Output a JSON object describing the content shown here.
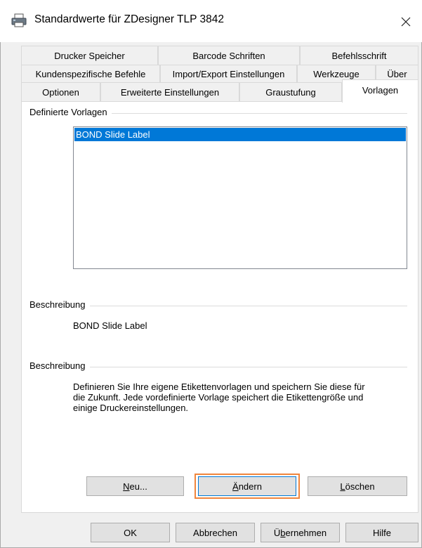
{
  "window": {
    "title": "Standardwerte für ZDesigner TLP 3842"
  },
  "tabs": {
    "row1": [
      "Drucker Speicher",
      "Barcode Schriften",
      "Befehlsschrift"
    ],
    "row2": [
      "Kundenspezifische Befehle",
      "Import/Export Einstellungen",
      "Werkzeuge",
      "Über"
    ],
    "row3": [
      "Optionen",
      "Erweiterte Einstellungen",
      "Graustufung",
      "Vorlagen"
    ],
    "active": "Vorlagen"
  },
  "templates": {
    "group_label": "Definierte Vorlagen",
    "items": [
      "BOND Slide Label"
    ],
    "selected": "BOND Slide Label"
  },
  "description1": {
    "group_label": "Beschreibung",
    "text": "BOND Slide Label"
  },
  "description2": {
    "group_label": "Beschreibung",
    "text_lines": [
      "Definieren Sie Ihre eigene Etikettenvorlagen und speichern Sie diese für",
      "die Zukunft. Jede vordefinierte Vorlage speichert die Etikettengröße und",
      "einige Druckereinstellungen."
    ]
  },
  "panel_buttons": {
    "new_prefix": "",
    "new_underline": "N",
    "new_rest": "eu...",
    "edit_underline": "Ä",
    "edit_rest": "ndern",
    "delete_underline": "L",
    "delete_rest": "öschen"
  },
  "footer_buttons": {
    "ok": "OK",
    "cancel": "Abbrechen",
    "apply_prefix": "Ü",
    "apply_underline": "b",
    "apply_rest": "ernehmen",
    "help": "Hilfe"
  },
  "colors": {
    "selection": "#0078d7",
    "focus_ring": "#f0853c"
  }
}
